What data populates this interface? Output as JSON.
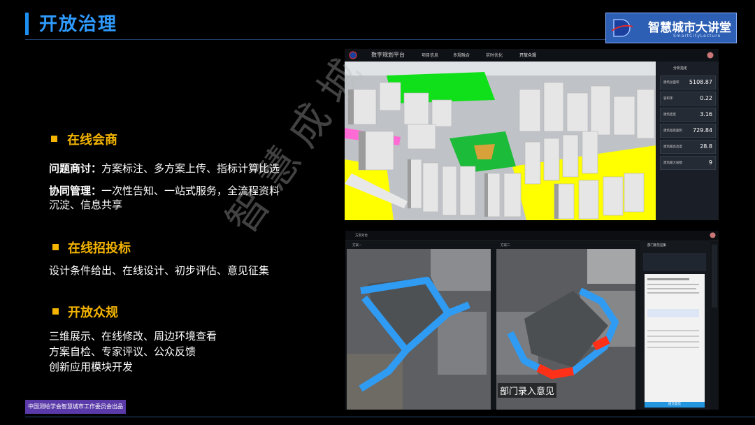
{
  "header": {
    "title": "开放治理",
    "logo_text": "智慧城市大讲堂",
    "logo_subtext": "SmartCityLecture"
  },
  "sections": [
    {
      "title": "在线会商",
      "lines": [
        {
          "label": "问题商讨：",
          "text": "方案标注、多方案上传、指标计算比选"
        },
        {
          "label": "协同管理：",
          "text": "一次性告知、一站式服务，全流程资料"
        },
        {
          "label": "",
          "text": "沉淀、信息共享"
        }
      ]
    },
    {
      "title": "在线招投标",
      "lines": [
        {
          "label": "",
          "text": "设计条件给出、在线设计、初步评估、意见征集"
        }
      ]
    },
    {
      "title": "开放众规",
      "lines": [
        {
          "label": "",
          "text": "三维展示、在线修改、周边环境查看"
        },
        {
          "label": "",
          "text": "方案自检、专家评议、公众反馈"
        },
        {
          "label": "",
          "text": "创新应用模块开发"
        }
      ]
    }
  ],
  "footer": {
    "badge": "中国测绘学会智慧城市工作委员会出品"
  },
  "watermark": "智慧成城",
  "screenshot1": {
    "app_name": "数字规划平台",
    "nav": [
      "项目信息",
      "多规融合",
      "实时优化",
      "开放众规"
    ],
    "panel_title": "分析指定",
    "metrics": [
      {
        "label": "建筑总面积",
        "value": "5108.87"
      },
      {
        "label": "容积率",
        "value": "0.22"
      },
      {
        "label": "建筑密度",
        "value": "3.16"
      },
      {
        "label": "建筑基底面积",
        "value": "729.84"
      },
      {
        "label": "建筑最高高度",
        "value": "28.8"
      },
      {
        "label": "建筑最大层数",
        "value": "9"
      }
    ]
  },
  "screenshot2": {
    "dropdown": "方案对比",
    "view_a": "方案一",
    "view_b": "方案二",
    "panel_title": "部门意见征集",
    "panel_button": "提交意见",
    "subtitle": "部门录入意见"
  }
}
